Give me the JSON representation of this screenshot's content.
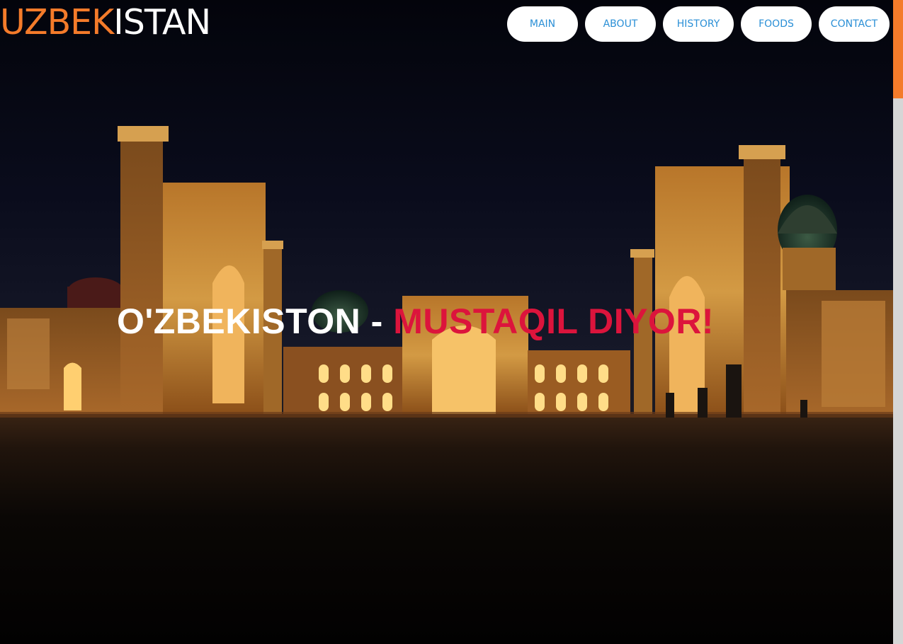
{
  "logo": {
    "accent": "UZBEK",
    "rest": "ISTAN"
  },
  "nav": {
    "items": [
      {
        "label": "MAIN"
      },
      {
        "label": "ABOUT"
      },
      {
        "label": "HISTORY"
      },
      {
        "label": "FOODS"
      },
      {
        "label": "CONTACT"
      }
    ]
  },
  "hero": {
    "headline_white": "O'ZBEKISTON",
    "headline_sep": " - ",
    "headline_red": "MUSTAQIL DIYOR!"
  },
  "colors": {
    "accent": "#f47b2a",
    "nav_text": "#2a8fd6",
    "headline_red": "#dc143c"
  }
}
